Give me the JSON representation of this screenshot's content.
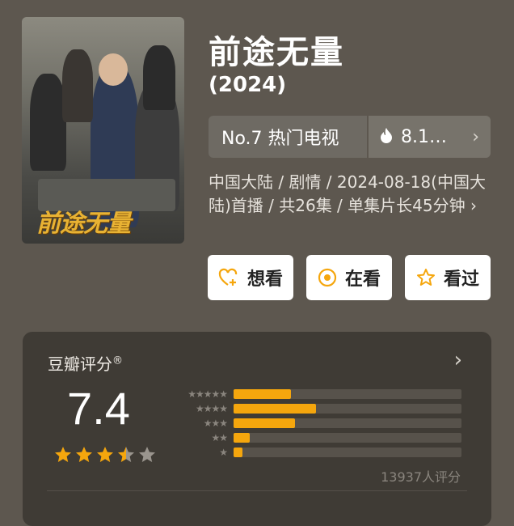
{
  "poster": {
    "title_text": "前途无量"
  },
  "title": "前途无量",
  "year": "(2024)",
  "rank": {
    "label": "No.7 热门电视",
    "heat": "8.1…",
    "icon": "flame-icon"
  },
  "meta": {
    "text": "中国大陆 / 剧情 / 2024-08-18(中国大陆)首播 / 共26集 / 单集片长45分钟 ›"
  },
  "actions": [
    {
      "label": "想看",
      "icon": "heart-plus-icon"
    },
    {
      "label": "在看",
      "icon": "target-icon"
    },
    {
      "label": "看过",
      "icon": "star-outline-icon"
    }
  ],
  "rating": {
    "header": "豆瓣评分",
    "header_mark": "®",
    "score": "7.4",
    "stars_value": 3.5,
    "count_text": "13937人评分",
    "distribution": [
      {
        "stars": "★★★★★",
        "fraction": 0.25
      },
      {
        "stars": "★★★★",
        "fraction": 0.36
      },
      {
        "stars": "★★★",
        "fraction": 0.27
      },
      {
        "stars": "★★",
        "fraction": 0.07
      },
      {
        "stars": "★",
        "fraction": 0.04
      }
    ]
  },
  "colors": {
    "accent": "#f5a60d",
    "background": "#5d574f",
    "card": "#3f3b35"
  }
}
